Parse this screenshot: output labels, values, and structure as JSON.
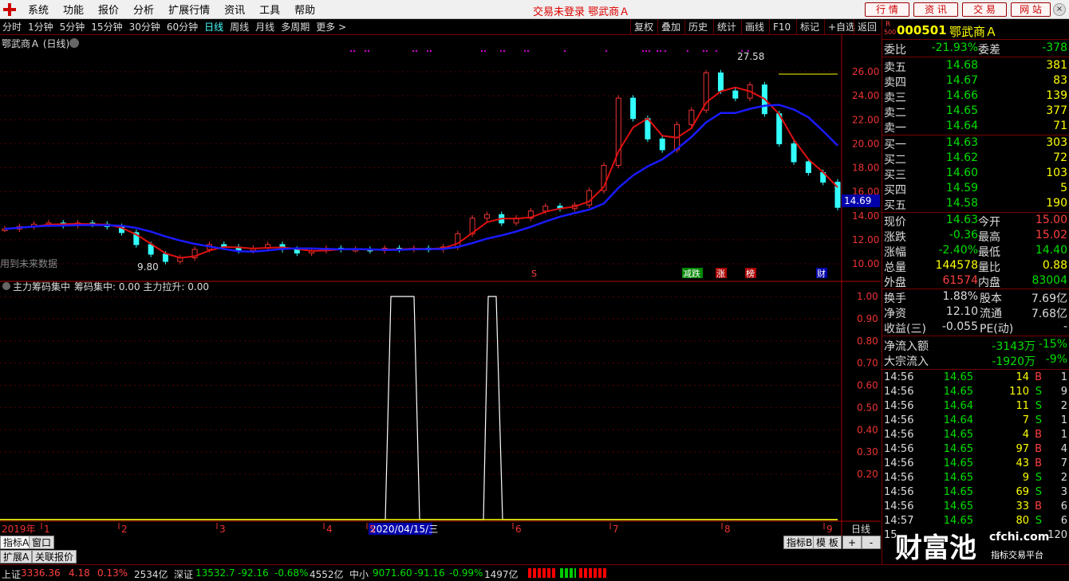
{
  "menu": {
    "items": [
      "系统",
      "功能",
      "报价",
      "分析",
      "扩展行情",
      "资讯",
      "工具",
      "帮助"
    ],
    "status": "交易未登录 鄂武商Ａ",
    "buttons": [
      "行 情",
      "资 讯",
      "交 易",
      "网 站"
    ]
  },
  "periods": [
    "分时",
    "1分钟",
    "5分钟",
    "15分钟",
    "30分钟",
    "60分钟",
    "日线",
    "周线",
    "月线",
    "多周期",
    "更多 >"
  ],
  "tools": [
    "复权",
    "叠加",
    "历史",
    "统计",
    "画线",
    "F10",
    "标记",
    "+自选",
    "返回"
  ],
  "chart": {
    "title": "鄂武商Ａ (日线)",
    "future_note": "用到未来数据",
    "high_label": "27.58",
    "low_label": "9.80",
    "price_tag": "14.69",
    "events": [
      "S",
      "减跌",
      "涨",
      "榜",
      "财"
    ],
    "indicator_title": "主力筹码集中",
    "indicator_vals": "筹码集中: 0.00  主力拉升: 0.00",
    "months": [
      "2019年",
      "1",
      "2",
      "3",
      "4",
      "2020/04/15/三",
      "5",
      "6",
      "7",
      "8",
      "9"
    ],
    "period_btn": "日线",
    "y_price": [
      "26.00",
      "24.00",
      "22.00",
      "20.00",
      "18.00",
      "16.00",
      "14.00",
      "12.00",
      "10.00"
    ],
    "y_ind": [
      "1.00",
      "0.90",
      "0.80",
      "0.70",
      "0.60",
      "0.50",
      "0.40",
      "0.30",
      "0.20"
    ]
  },
  "chart_data": {
    "type": "line",
    "title": "鄂武商Ａ (日线)",
    "ylim": [
      9,
      27.6
    ],
    "months": [
      "2019年",
      "1",
      "2",
      "3",
      "4",
      "5",
      "6",
      "7",
      "8",
      "9"
    ],
    "price": [
      12.9,
      13.1,
      13.3,
      13.4,
      13.2,
      13.4,
      13.3,
      13.1,
      12.6,
      11.6,
      10.8,
      10.2,
      10.5,
      11.2,
      11.6,
      11.4,
      11.1,
      11.3,
      11.6,
      11.2,
      10.9,
      11.1,
      11.3,
      11.2,
      11.2,
      11.1,
      11.3,
      11.2,
      11.3,
      11.2,
      11.4,
      12.5,
      13.8,
      14.1,
      13.4,
      13.8,
      14.4,
      14.8,
      14.6,
      14.9,
      16.1,
      18.2,
      23.8,
      22.1,
      20.4,
      19.5,
      21.6,
      22.8,
      25.9,
      24.4,
      23.8,
      24.9,
      22.5,
      20.0,
      18.5,
      17.6,
      16.8,
      14.7
    ]
  },
  "quote": {
    "code": "000501",
    "name": "鄂武商Ａ",
    "weibi_label": "委比",
    "weibi": "-21.93%",
    "weicha_label": "委差",
    "weicha": "-378",
    "asks": [
      {
        "label": "卖五",
        "price": "14.68",
        "vol": "381"
      },
      {
        "label": "卖四",
        "price": "14.67",
        "vol": "83"
      },
      {
        "label": "卖三",
        "price": "14.66",
        "vol": "139"
      },
      {
        "label": "卖二",
        "price": "14.65",
        "vol": "377"
      },
      {
        "label": "卖一",
        "price": "14.64",
        "vol": "71"
      }
    ],
    "bids": [
      {
        "label": "买一",
        "price": "14.63",
        "vol": "303"
      },
      {
        "label": "买二",
        "price": "14.62",
        "vol": "72"
      },
      {
        "label": "买三",
        "price": "14.60",
        "vol": "103"
      },
      {
        "label": "买四",
        "price": "14.59",
        "vol": "5"
      },
      {
        "label": "买五",
        "price": "14.58",
        "vol": "190"
      }
    ],
    "stats": [
      [
        "现价",
        "14.63",
        "今开",
        "15.00"
      ],
      [
        "涨跌",
        "-0.36",
        "最高",
        "15.02"
      ],
      [
        "涨幅",
        "-2.40%",
        "最低",
        "14.40"
      ],
      [
        "总量",
        "144578",
        "量比",
        "0.88"
      ],
      [
        "外盘",
        "61574",
        "内盘",
        "83004"
      ]
    ],
    "stats2": [
      [
        "换手",
        "1.88%",
        "股本",
        "7.69亿"
      ],
      [
        "净资",
        "12.10",
        "流通",
        "7.68亿"
      ],
      [
        "收益(三)",
        "-0.055",
        "PE(动)",
        "-"
      ]
    ],
    "flow": [
      [
        "净流入额",
        "-3143万",
        "-15%"
      ],
      [
        "大宗流入",
        "-1920万",
        "-9%"
      ]
    ],
    "ticks": [
      [
        "14:56",
        "14.65",
        "14",
        "B",
        "1"
      ],
      [
        "14:56",
        "14.65",
        "110",
        "S",
        "9"
      ],
      [
        "14:56",
        "14.64",
        "11",
        "S",
        "2"
      ],
      [
        "14:56",
        "14.64",
        "7",
        "S",
        "1"
      ],
      [
        "14:56",
        "14.65",
        "4",
        "B",
        "1"
      ],
      [
        "14:56",
        "14.65",
        "97",
        "B",
        "4"
      ],
      [
        "14:56",
        "14.65",
        "43",
        "B",
        "7"
      ],
      [
        "14:56",
        "14.65",
        "9",
        "S",
        "2"
      ],
      [
        "14:56",
        "14.65",
        "69",
        "S",
        "3"
      ],
      [
        "14:56",
        "14.65",
        "33",
        "B",
        "6"
      ],
      [
        "14:57",
        "14.65",
        "80",
        "S",
        "6"
      ],
      [
        "15",
        "",
        "",
        "",
        "120"
      ]
    ]
  },
  "tabs": {
    "left": [
      "指标A",
      "窗口"
    ],
    "left2": [
      "扩展A",
      "关联报价"
    ],
    "right": [
      "指标B",
      "模 板",
      "+",
      "-"
    ]
  },
  "bottom": {
    "sh_label": "上证",
    "sh": "3336.36",
    "sh_chg": "4.18",
    "sh_pct": "0.13%",
    "sh_amt": "2534亿",
    "sz_label": "深证",
    "sz": "13532.7",
    "sz_chg": "-92.16",
    "sz_pct": "-0.68%",
    "sz_amt": "4552亿",
    "zx_label": "中小",
    "zx": "9071.60",
    "zx_chg": "-91.16",
    "zx_pct": "-0.99%",
    "zx_amt": "1497亿"
  },
  "watermark": {
    "cn": "财富池",
    "url": "cfchi.com",
    "sub": "指标交易平台"
  }
}
